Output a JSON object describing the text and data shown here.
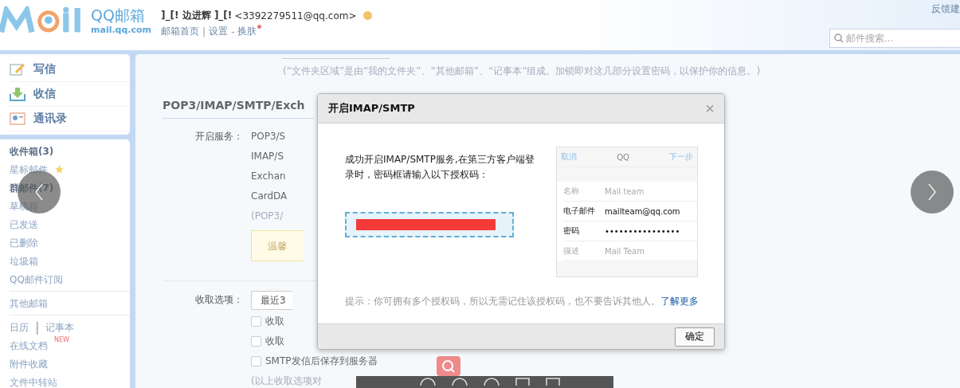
{
  "header": {
    "logo_text": "QQ邮箱",
    "logo_domain": "mail.qq.com",
    "user": "]_[! 边进辉 ]_[!",
    "email": "<3392279511@qq.com>",
    "links": [
      "邮箱首页",
      "设置",
      "换肤"
    ],
    "link_separators": [
      "|",
      "-"
    ],
    "feedback": "反馈建",
    "search": {
      "placeholder": "邮件搜索..."
    }
  },
  "actions": [
    {
      "label": "写信",
      "kind": "compose"
    },
    {
      "label": "收信",
      "kind": "receive"
    },
    {
      "label": "通讯录",
      "kind": "contacts"
    }
  ],
  "folder_groups": [
    [
      {
        "label": "收件箱(3)",
        "unread": true
      },
      {
        "label": "星标邮件",
        "unread": false,
        "star": true
      },
      {
        "label": "群邮件(7)",
        "unread": true
      },
      {
        "label": "草稿箱",
        "unread": false
      },
      {
        "label": "已发送",
        "unread": false
      },
      {
        "label": "已删除",
        "unread": false
      },
      {
        "label": "垃圾箱",
        "unread": false
      },
      {
        "label": "QQ邮件订阅",
        "unread": false
      }
    ],
    [
      {
        "label": "其他邮箱",
        "unread": false
      }
    ],
    [
      {
        "label": "日历",
        "unread": false,
        "pair": "记事本",
        "separator": "|"
      },
      {
        "label": "在线文档",
        "unread": false,
        "badge": "NEW"
      },
      {
        "label": "附件收藏",
        "unread": false
      },
      {
        "label": "文件中转站",
        "unread": false
      }
    ]
  ],
  "settings": {
    "note": "(“文件夹区域”是由“我的文件夹”、“其他邮箱”、“记事本”组成。加锁即对这几部分设置密码，以保护你的信息。)",
    "section_title": "POP3/IMAP/SMTP/Exch",
    "service_label": "开启服务：",
    "services": [
      "POP3/S",
      "IMAP/S",
      "Exchan",
      "CardDA"
    ],
    "service_note": "(POP3/",
    "tip_box": "温馨",
    "fetch_label": "收取选项：",
    "fetch_select": "最近3",
    "options": [
      {
        "label": "收取",
        "checked": false
      },
      {
        "label": "收取",
        "checked": false
      },
      {
        "label": "SMTP发信后保存到服务器",
        "checked": false
      }
    ],
    "footnote": "(以上收取选项对"
  },
  "dialog": {
    "title": "开启IMAP/SMTP",
    "close": "×",
    "message": "成功开启IMAP/SMTP服务,在第三方客户端登录时，密码框请输入以下授权码：",
    "preview": {
      "cancel": "取消",
      "title": "QQ",
      "next": "下一步",
      "rows": [
        {
          "label": "名称",
          "value": "Mail team",
          "kind": "hint"
        },
        {
          "label": "电子邮件",
          "value": "mailteam@qq.com",
          "kind": "filled"
        },
        {
          "label": "密码",
          "value": "••••••••••••••••",
          "kind": "filled"
        },
        {
          "label": "描述",
          "value": "Mail Team",
          "kind": "hint"
        }
      ]
    },
    "hint": "提示：你可拥有多个授权码，所以无需记住该授权码，也不要告诉其他人。",
    "hint_link": "了解更多",
    "ok": "确定"
  }
}
